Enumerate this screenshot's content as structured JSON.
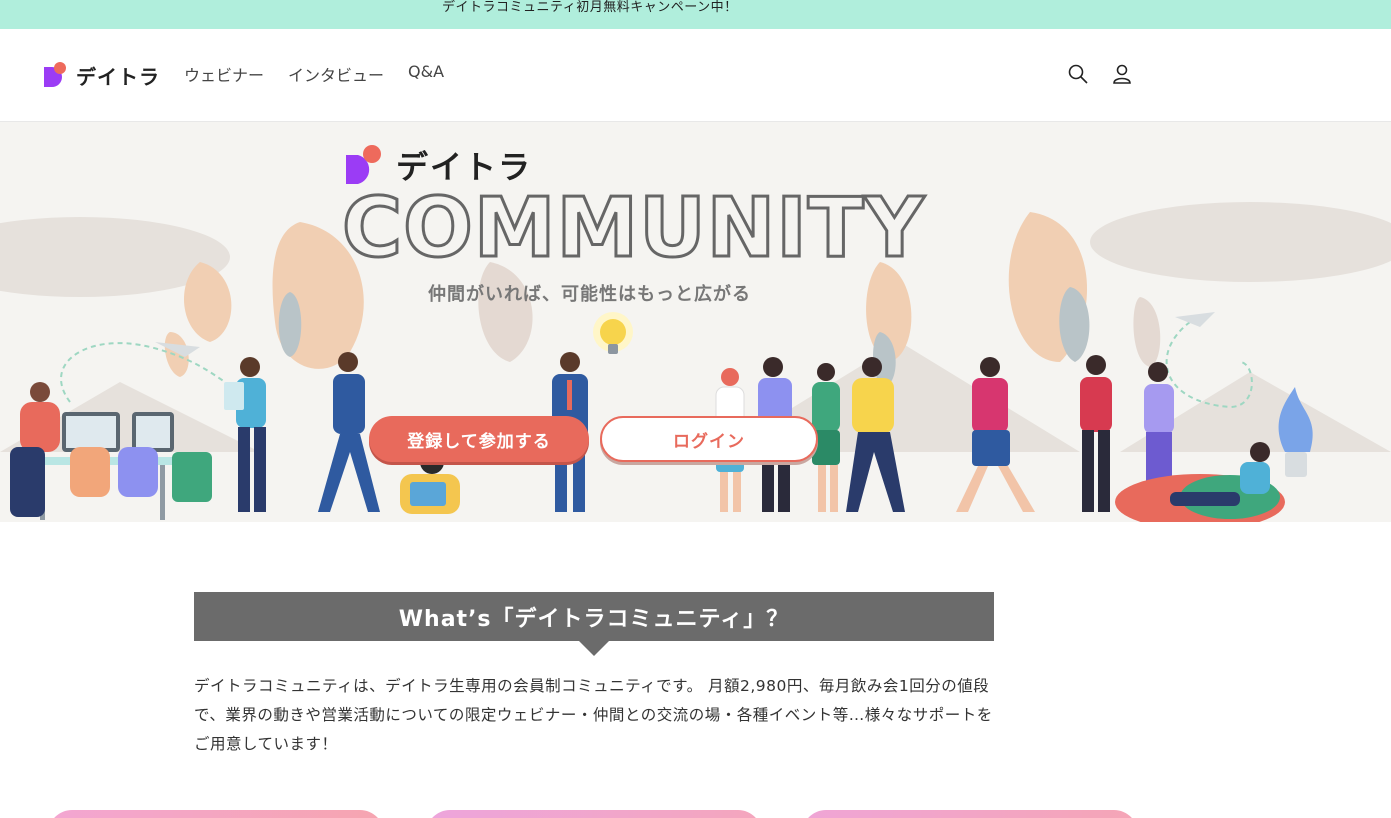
{
  "announcement": "デイトラコミュニティ初月無料キャンペーン中！",
  "header": {
    "logo_text": "デイトラ",
    "nav": [
      "ウェビナー",
      "インタビュー",
      "Q&A"
    ],
    "search_icon": "search-icon",
    "account_icon": "account-icon"
  },
  "hero": {
    "logo_text": "デイトラ",
    "title": "COMMUNITY",
    "tagline": "仲間がいれば、可能性はもっと広がる",
    "register_button": "登録して参加する",
    "login_button": "ログイン"
  },
  "about": {
    "heading": "What’s「デイトラコミュニティ」？",
    "body": "デイトラコミュニティは、デイトラ生専用の会員制コミュニティです。 月額2,980円、毎月飲み会1回分の値段で、業界の動きや営業活動についての限定ウェビナー・仲間との交流の場・各種イベント等…様々なサポートをご用意しています！"
  },
  "colors": {
    "announce_bg": "#b0eedc",
    "accent": "#e86a5c",
    "logo_purple": "#9b3cf5",
    "logo_red": "#ee6a5c",
    "heading_bg": "#6b6b6b"
  }
}
